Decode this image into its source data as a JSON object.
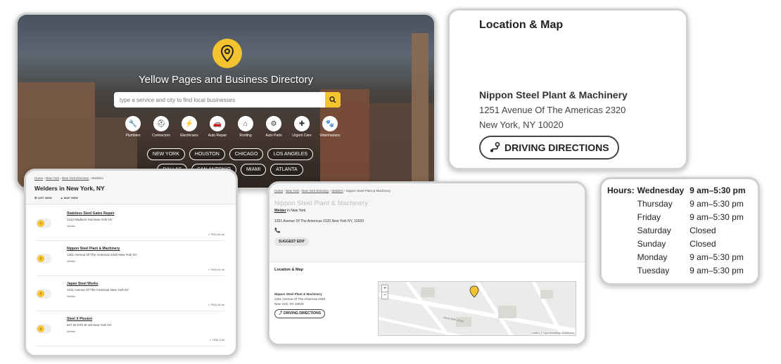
{
  "hero": {
    "title": "Yellow Pages and Business Directory",
    "search_placeholder": "type a service and city to find local businesses",
    "categories": [
      {
        "label": "Plumbers",
        "icon": "wrench-icon"
      },
      {
        "label": "Contractors",
        "icon": "hardhat-icon"
      },
      {
        "label": "Electricians",
        "icon": "plug-icon"
      },
      {
        "label": "Auto Repair",
        "icon": "car-icon"
      },
      {
        "label": "Roofing",
        "icon": "house-icon"
      },
      {
        "label": "Auto Parts",
        "icon": "car-parts-icon"
      },
      {
        "label": "Urgent Care",
        "icon": "medical-kit-icon"
      },
      {
        "label": "Veterinarians",
        "icon": "paw-icon"
      }
    ],
    "cities": [
      "NEW YORK",
      "HOUSTON",
      "CHICAGO",
      "LOS ANGELES",
      "DALLAS",
      "SAN ANTONIO",
      "MIAMI",
      "ATLANTA"
    ]
  },
  "location_map": {
    "title": "Location & Map",
    "business_name": "Nippon Steel Plant & Machinery",
    "address_line1": "1251 Avenue Of The Americas 2320",
    "address_line2": "New York, NY 10020",
    "directions_label": "DRIVING DIRECTIONS"
  },
  "hours": {
    "label": "Hours:",
    "days": [
      {
        "day": "Wednesday",
        "time": "9 am–5:30 pm",
        "today": true
      },
      {
        "day": "Thursday",
        "time": "9 am–5:30 pm",
        "today": false
      },
      {
        "day": "Friday",
        "time": "9 am–5:30 pm",
        "today": false
      },
      {
        "day": "Saturday",
        "time": "Closed",
        "today": false
      },
      {
        "day": "Sunday",
        "time": "Closed",
        "today": false
      },
      {
        "day": "Monday",
        "time": "9 am–5:30 pm",
        "today": false
      },
      {
        "day": "Tuesday",
        "time": "9 am–5:30 pm",
        "today": false
      }
    ]
  },
  "listing": {
    "breadcrumb": [
      "Home",
      "New York",
      "New York Directory",
      "Welders"
    ],
    "title": "Welders in New York, NY",
    "views": [
      "LIST VIEW",
      "MAP VIEW"
    ],
    "items": [
      {
        "rank": "1",
        "name": "Stainless Steel Gates Repair",
        "address": "1412 Madison Ave New York NY",
        "type": "Welder",
        "distance": "≈ 7521.69 mi"
      },
      {
        "rank": "2",
        "name": "Nippon Steel Plant & Machinery",
        "address": "1251 Avenue Of The Americas 2320 New York NY",
        "type": "Welder",
        "distance": "≈ 7534.14 mi"
      },
      {
        "rank": "3",
        "name": "Japan Steel Works",
        "address": "1211 Avenue Of The Americas New York NY",
        "type": "Welder",
        "distance": "≈ 7534.24 mi"
      },
      {
        "rank": "4",
        "name": "Steel X Plosion",
        "address": "527 W 47th St 1M New York NY",
        "type": "Welder",
        "distance": "≈ 7534.3 mi"
      }
    ]
  },
  "detail": {
    "breadcrumb": [
      "Home",
      "New York",
      "New York Directory",
      "Welders",
      "Nippon Steel Plant & Machinery"
    ],
    "name": "Nippon Steel Plant & Machinery",
    "category": "Welder",
    "category_suffix": " in New York",
    "address": "1251 Avenue Of The Americas 2320 New York NY, 10020",
    "suggest_label": "SUGGEST EDIT",
    "loc_title": "Location & Map",
    "loc_name": "Nippon Steel Plant & Machinery",
    "loc_line1": "1251 Avenue Of The Americas 2320",
    "loc_line2": "New York, NY 10020",
    "directions_label": "DRIVING DIRECTIONS",
    "map_attribution": "Leaflet | © OpenStreetMap contributors",
    "map_street": "West 48th Street"
  },
  "colors": {
    "accent": "#f4c430"
  }
}
